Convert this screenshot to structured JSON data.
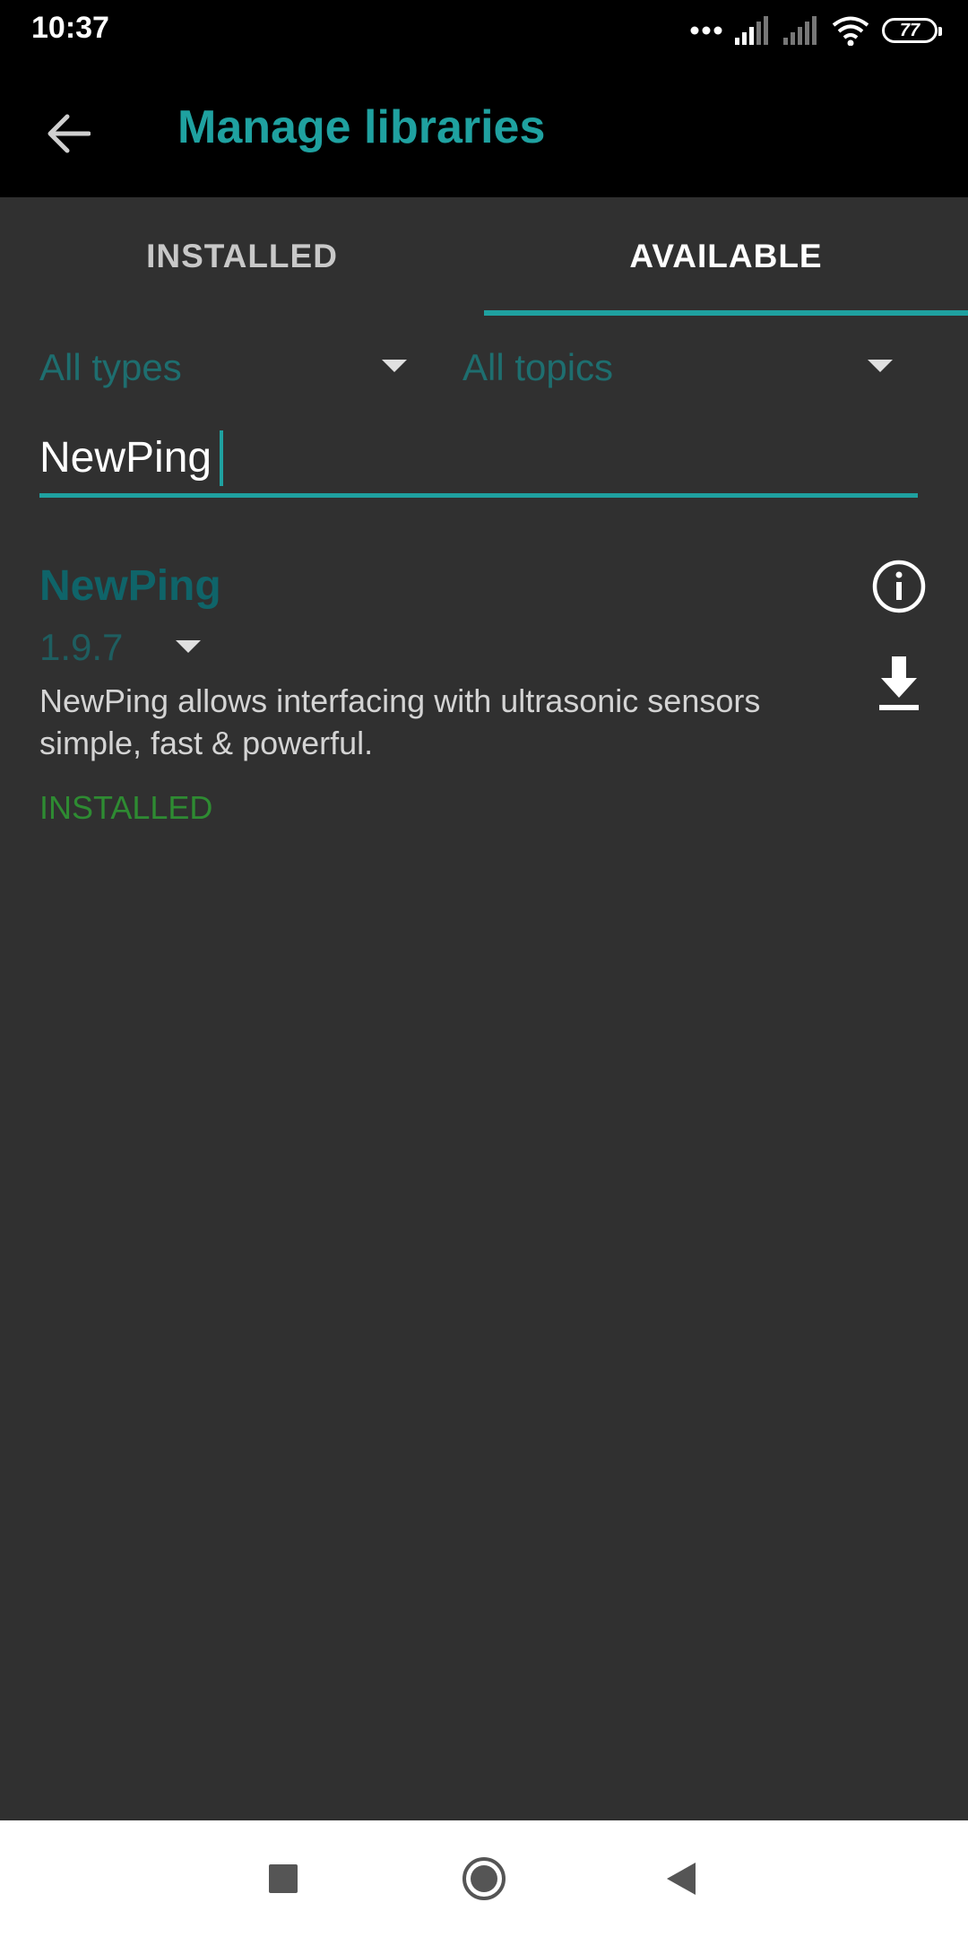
{
  "status_bar": {
    "time": "10:37",
    "battery": "77",
    "icons": [
      "more-dots-icon",
      "signal-icon",
      "signal-icon",
      "wifi-icon",
      "battery-icon"
    ]
  },
  "app_bar": {
    "back_icon": "arrow-left-icon",
    "title": "Manage libraries"
  },
  "tabs": [
    {
      "label": "INSTALLED",
      "selected": false
    },
    {
      "label": "AVAILABLE",
      "selected": true
    }
  ],
  "filters": {
    "type": "All types",
    "topic": "All topics"
  },
  "search": {
    "value": "NewPing"
  },
  "libraries": [
    {
      "name": "NewPing",
      "version": "1.9.7",
      "description": "NewPing allows interfacing with ultrasonic sensors simple, fast & powerful.",
      "status": "INSTALLED"
    }
  ],
  "colors": {
    "accent": "#1fa1a0",
    "background": "#303030",
    "installed_status": "#2e8b32"
  },
  "nav_bar": {
    "icons": [
      "recents-square-icon",
      "home-circle-icon",
      "back-triangle-icon"
    ]
  }
}
